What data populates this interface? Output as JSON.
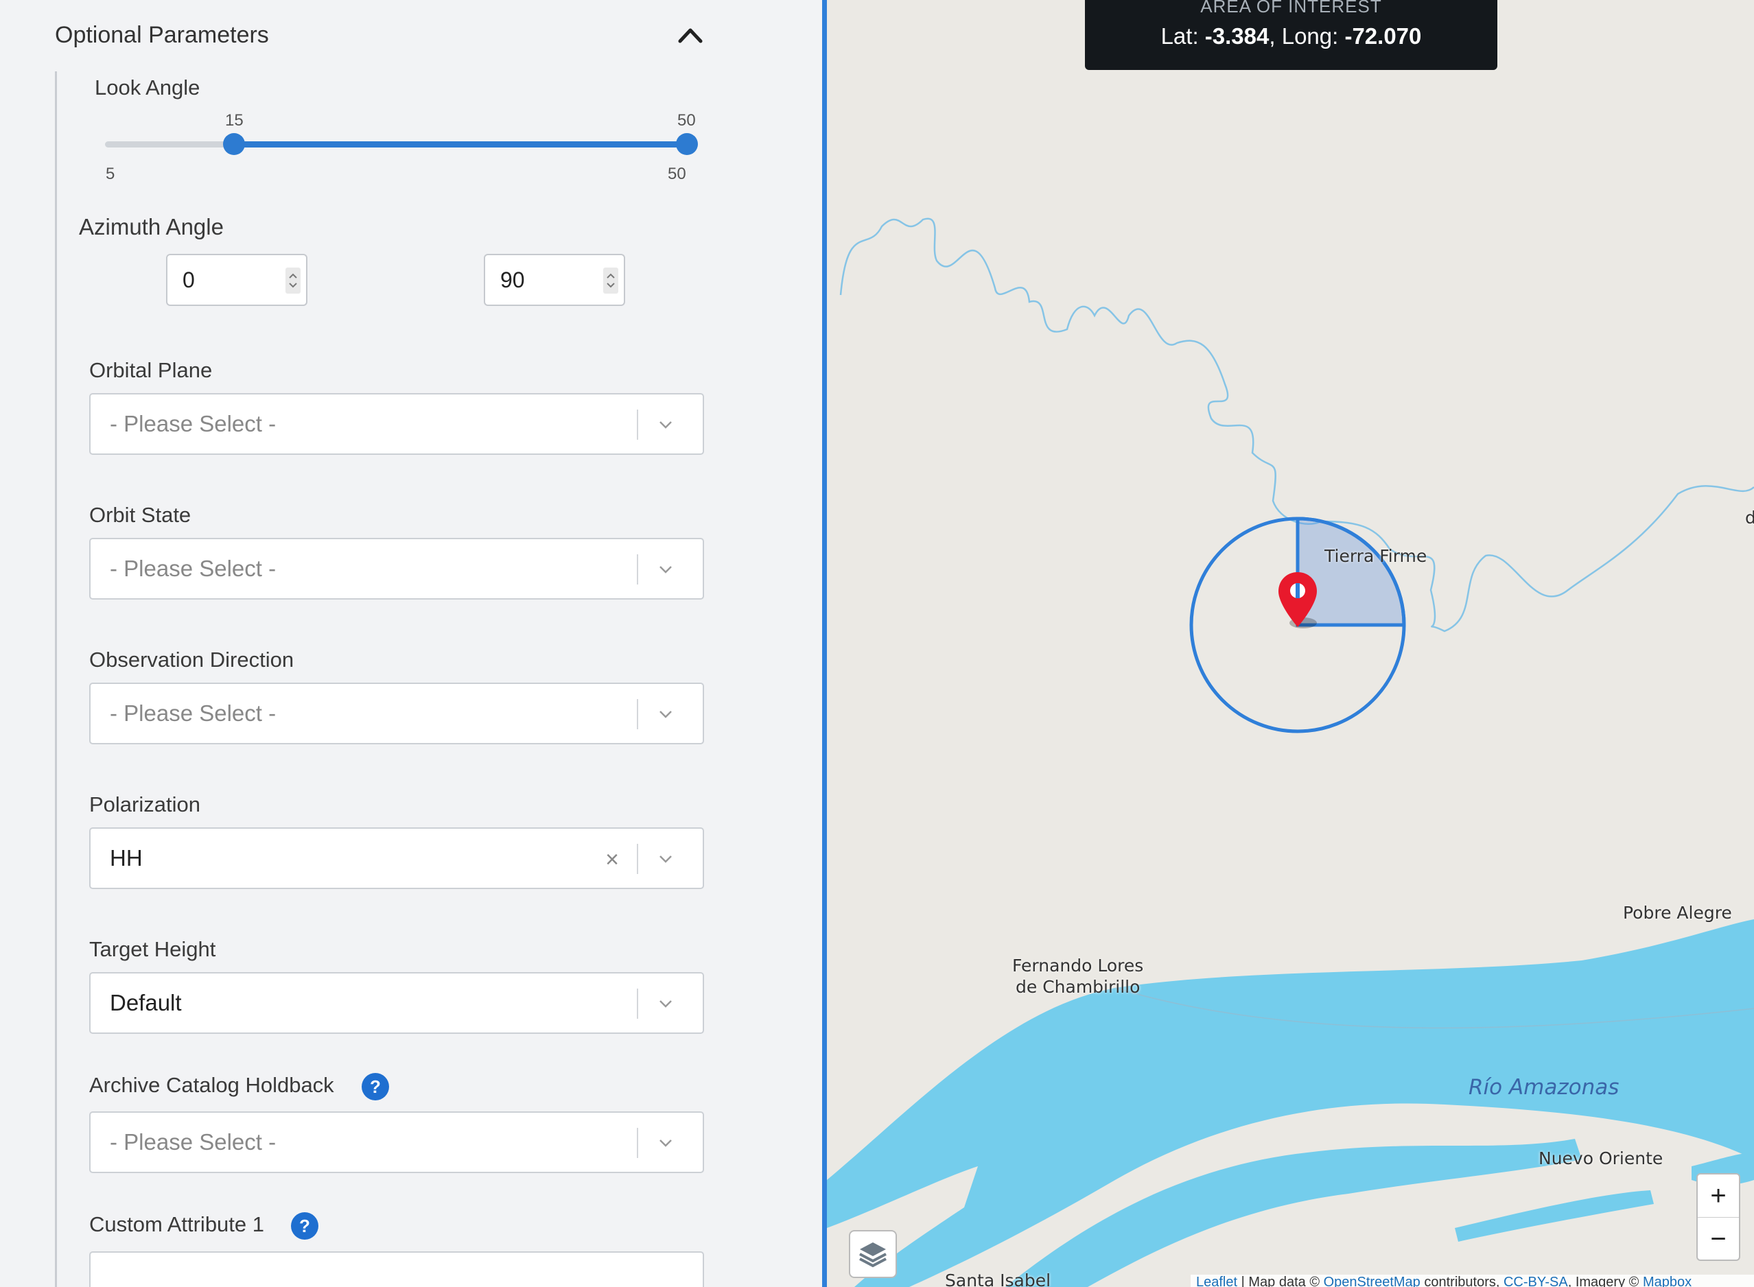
{
  "panel": {
    "title": "Optional Parameters",
    "look_angle": {
      "label": "Look Angle",
      "min": 5,
      "max": 50,
      "low": 15,
      "high": 50,
      "min_label": "5",
      "max_label": "50",
      "low_label": "15",
      "high_label": "50"
    },
    "azimuth": {
      "label": "Azimuth Angle",
      "from": "0",
      "to": "90"
    },
    "fields": [
      {
        "label": "Orbital Plane",
        "value": "- Please Select -",
        "placeholder": true
      },
      {
        "label": "Orbit State",
        "value": "- Please Select -",
        "placeholder": true
      },
      {
        "label": "Observation Direction",
        "value": "- Please Select -",
        "placeholder": true
      },
      {
        "label": "Polarization",
        "value": "HH",
        "placeholder": false,
        "clear": "×"
      },
      {
        "label": "Target Height",
        "value": "Default",
        "placeholder": false
      },
      {
        "label": "Archive Catalog Holdback",
        "value": "- Please Select -",
        "placeholder": true,
        "help": "?"
      },
      {
        "label": "Custom Attribute 1",
        "value": "",
        "placeholder": false,
        "help": "?"
      }
    ]
  },
  "map": {
    "aoi_title": "AREA OF INTEREST",
    "lat_label": "Lat: ",
    "lat": "-3.384",
    "long_label": ", Long: ",
    "long": "-72.070",
    "places": {
      "tierra_firme": "Tierra Firme",
      "pobre_alegre": "Pobre Alegre",
      "fernando_1": "Fernando Lores",
      "fernando_2": "de Chambirillo",
      "rio": "Río Amazonas",
      "nuevo_oriente": "Nuevo Oriente",
      "santa_isabel": "Santa Isabel",
      "edge_d": "d"
    },
    "zoom_in": "+",
    "zoom_out": "−",
    "attribution": {
      "leaflet": "Leaflet",
      "text1": " | Map data © ",
      "osm": "OpenStreetMap",
      "text2": " contributors, ",
      "license": "CC-BY-SA",
      "text3": ", Imagery © ",
      "mapbox": "Mapbox"
    },
    "colors": {
      "water": "#74cdec",
      "accent": "#2f7fd9",
      "marker": "#e8192c"
    }
  }
}
